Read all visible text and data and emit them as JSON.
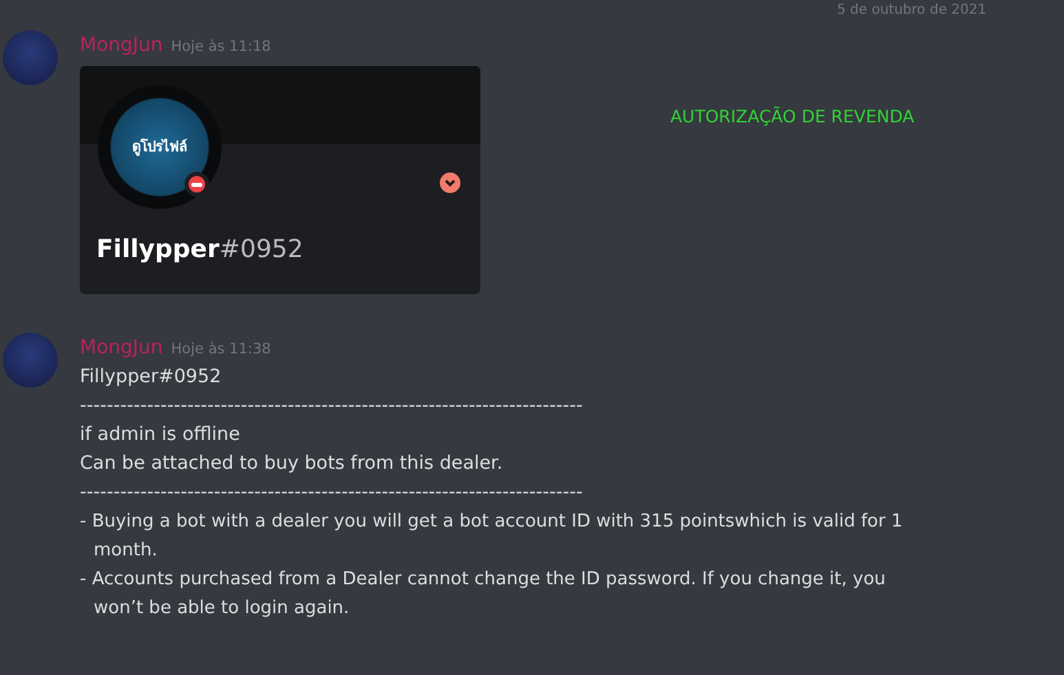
{
  "date_divider": "5 de outubro de 2021",
  "overlay_label": "AUTORIZAÇÃO DE REVENDA",
  "messages": [
    {
      "kind": "profile_card",
      "author": "MongJun",
      "timestamp": "Hoje às 11:18",
      "card": {
        "avatar_hover_text": "ดูโปรไฟล์",
        "do_not_disturb": true,
        "username": "Fillypper",
        "discriminator": "#0952"
      }
    },
    {
      "kind": "text",
      "author": "MongJun",
      "timestamp": "Hoje às 11:38",
      "lines": [
        {
          "kind": "plain",
          "text": "Fillypper#0952"
        },
        {
          "kind": "plain",
          "text": "---------------------------------------------------------------------------"
        },
        {
          "kind": "plain",
          "text": "if admin is offline"
        },
        {
          "kind": "plain",
          "text": "Can be attached to buy bots from this dealer."
        },
        {
          "kind": "plain",
          "text": "---------------------------------------------------------------------------"
        },
        {
          "kind": "bullet",
          "text": "- Buying a bot with a dealer you will get a bot account ID with 315 pointswhich is valid for 1 month."
        },
        {
          "kind": "bullet",
          "text": "- Accounts purchased from a Dealer cannot change the ID password. If you change it, you won’t be able to login again."
        }
      ]
    }
  ]
}
